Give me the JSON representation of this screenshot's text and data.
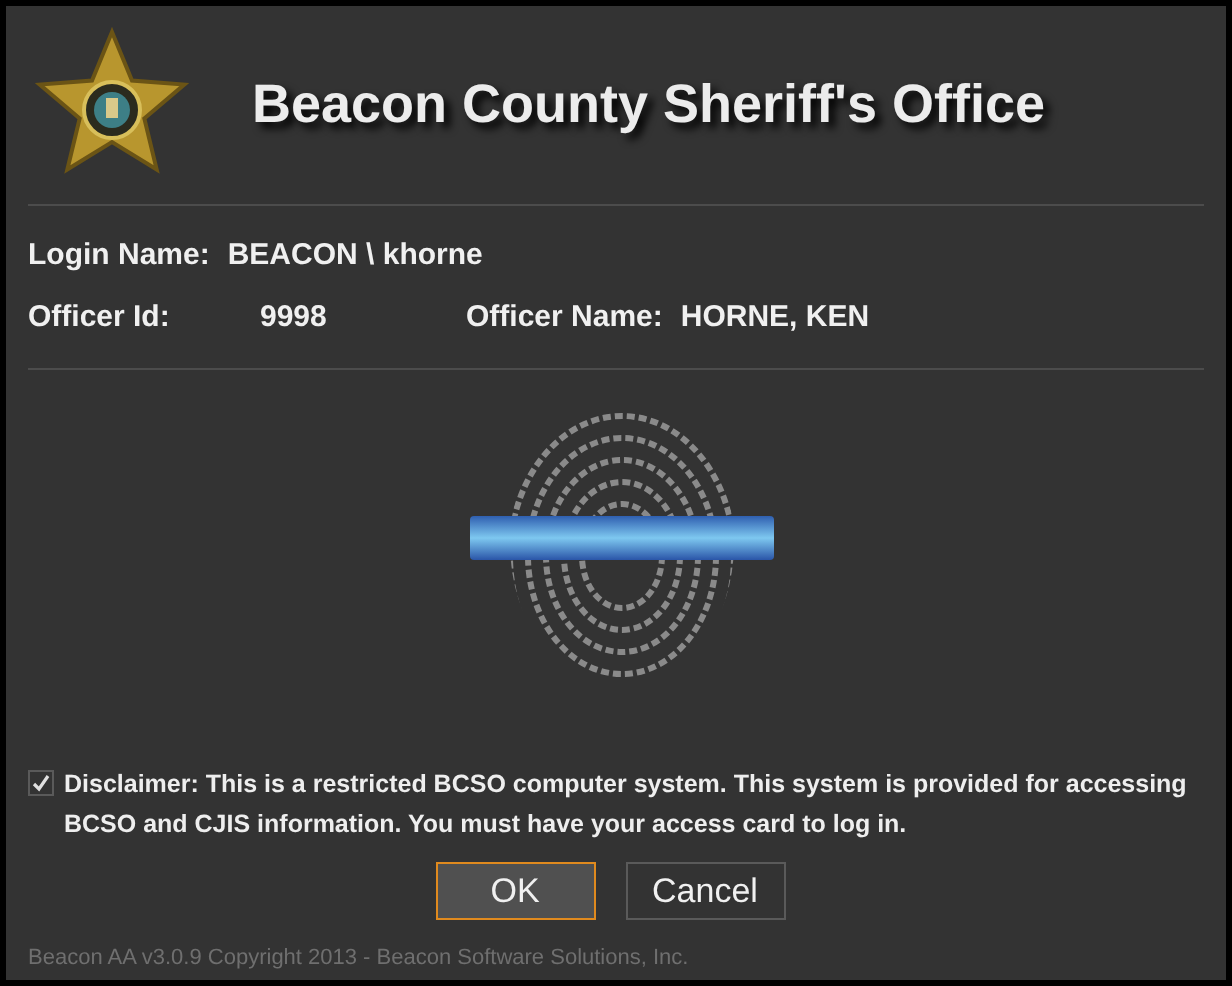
{
  "header": {
    "title": "Beacon County Sheriff's Office"
  },
  "fields": [
    {
      "label": "Login Name:",
      "value": "BEACON \\ khorne"
    },
    {
      "label": "Officer Id:",
      "value": "9998"
    },
    {
      "label": "Officer Name:",
      "value": "HORNE, KEN"
    }
  ],
  "disclaimer": {
    "checked": true,
    "text": "Disclaimer: This is a restricted BCSO computer system.  This system is provided for accessing BCSO and CJIS information.  You must have your access card to log in."
  },
  "buttons": [
    {
      "label": "OK",
      "focused": true
    },
    {
      "label": "Cancel",
      "focused": false
    }
  ],
  "footer": "Beacon AA v3.0.9 Copyright 2013 - Beacon Software Solutions, Inc."
}
